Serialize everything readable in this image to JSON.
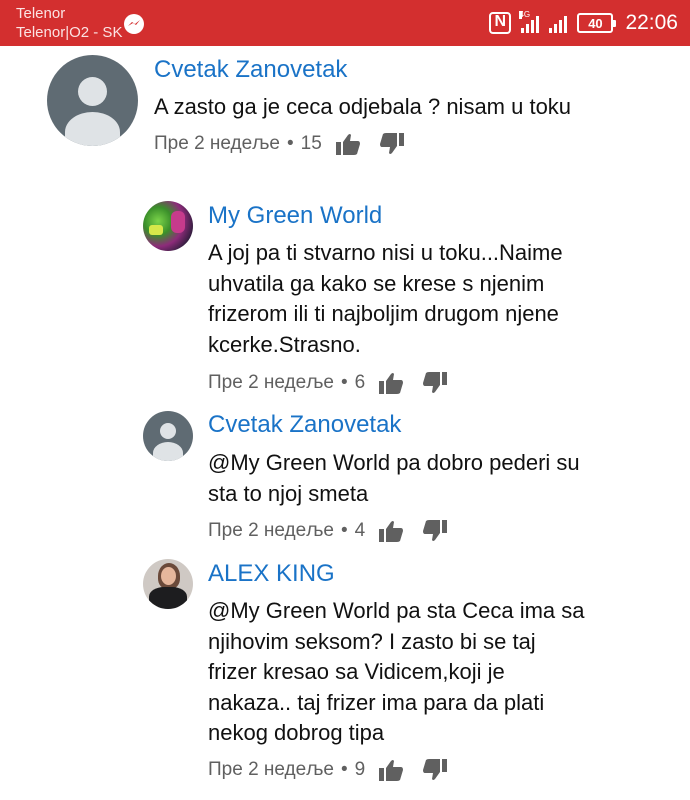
{
  "status_bar": {
    "carrier_line1": "Telenor",
    "carrier_line2": "Telenor|O2 - SK",
    "network_label": "4G",
    "battery": "40",
    "time": "22:06",
    "icons": [
      "messenger-icon",
      "nfc-icon",
      "cell-signal-icon",
      "cell-signal-icon",
      "battery-icon"
    ]
  },
  "comments": [
    {
      "author": "Cvetak Zanovetak",
      "lines": [
        "A zasto ga je ceca odjebala ?  nisam u toku"
      ],
      "time": "Пре 2 недеље",
      "likes": "15",
      "avatar": "default"
    },
    {
      "author": "My Green World",
      "lines": [
        "A joj pa ti stvarno nisi u toku...Naime",
        "uhvatila ga kako se krese s njenim",
        "frizerom ili ti najboljim drugom njene",
        "kcerke.Strasno."
      ],
      "time": "Пре 2 недеље",
      "likes": "6",
      "avatar": "photo-green"
    },
    {
      "author": "Cvetak Zanovetak",
      "lines": [
        "@My Green World pa dobro pederi su",
        "sta to njoj smeta"
      ],
      "time": "Пре 2 недеље",
      "likes": "4",
      "avatar": "default"
    },
    {
      "author": "ALEX KING",
      "lines": [
        "@My Green World pa sta Ceca ima sa",
        "njihovim seksom? I zasto bi se taj",
        "frizer kresao sa Vidicem,koji je",
        "nakaza.. taj frizer ima para da plati",
        "nekog dobrog tipa"
      ],
      "time": "Пре 2 недеље",
      "likes": "9",
      "avatar": "photo-person"
    }
  ],
  "colors": {
    "status_bar": "#d32f2f",
    "author": "#1a73c7",
    "meta": "#606060",
    "text": "#111111"
  }
}
